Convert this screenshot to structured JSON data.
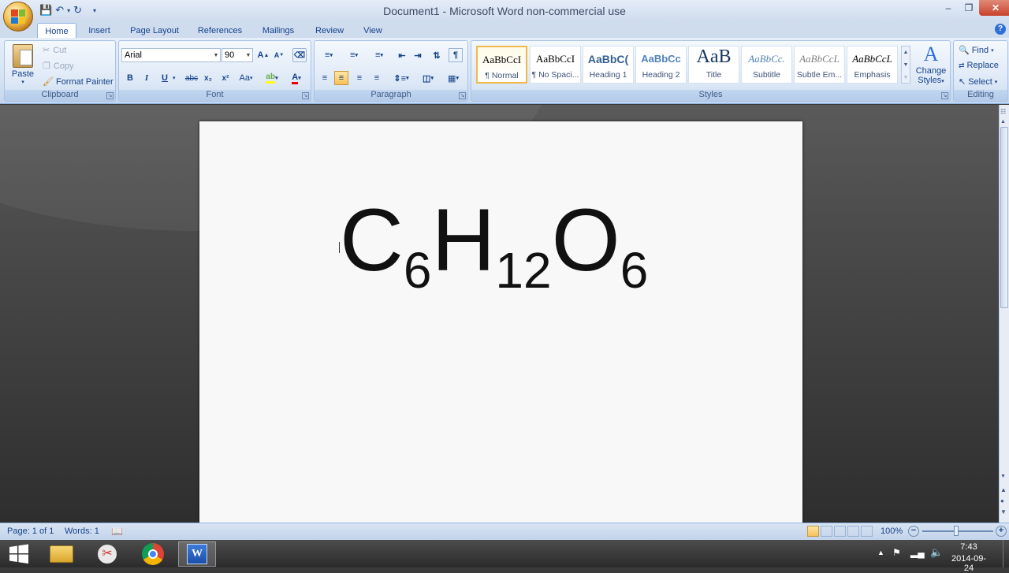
{
  "window": {
    "title": "Document1 - Microsoft Word non-commercial use"
  },
  "tabs": [
    "Home",
    "Insert",
    "Page Layout",
    "References",
    "Mailings",
    "Review",
    "View"
  ],
  "clipboard": {
    "group_label": "Clipboard",
    "paste": "Paste",
    "cut": "Cut",
    "copy": "Copy",
    "format_painter": "Format Painter"
  },
  "font": {
    "group_label": "Font",
    "name": "Arial",
    "size": "90",
    "bold": "B",
    "italic": "I",
    "underline": "U",
    "strike": "abc",
    "subscript": "x₂",
    "superscript": "x²",
    "change_case": "Aa"
  },
  "paragraph": {
    "group_label": "Paragraph"
  },
  "styles": {
    "group_label": "Styles",
    "items": [
      {
        "sample": "AaBbCcI",
        "name": "¶ Normal"
      },
      {
        "sample": "AaBbCcI",
        "name": "¶ No Spaci..."
      },
      {
        "sample": "AaBbC(",
        "name": "Heading 1"
      },
      {
        "sample": "AaBbCc",
        "name": "Heading 2"
      },
      {
        "sample": "AaB",
        "name": "Title"
      },
      {
        "sample": "AaBbCc.",
        "name": "Subtitle"
      },
      {
        "sample": "AaBbCcL",
        "name": "Subtle Em..."
      },
      {
        "sample": "AaBbCcL",
        "name": "Emphasis"
      }
    ],
    "change_styles_1": "Change",
    "change_styles_2": "Styles"
  },
  "editing": {
    "group_label": "Editing",
    "find": "Find",
    "replace": "Replace",
    "select": "Select"
  },
  "document": {
    "c": "C",
    "c_n": "6",
    "h": "H",
    "h_n": "12",
    "o": "O",
    "o_n": "6"
  },
  "status": {
    "page": "Page: 1 of 1",
    "words": "Words: 1",
    "zoom": "100%"
  },
  "taskbar": {
    "time": "7:43",
    "date": "2014-09-24"
  },
  "colors": {
    "ribbon": "#dbe6f4",
    "workspace": "#4a4a4a",
    "accent": "#15428b"
  }
}
